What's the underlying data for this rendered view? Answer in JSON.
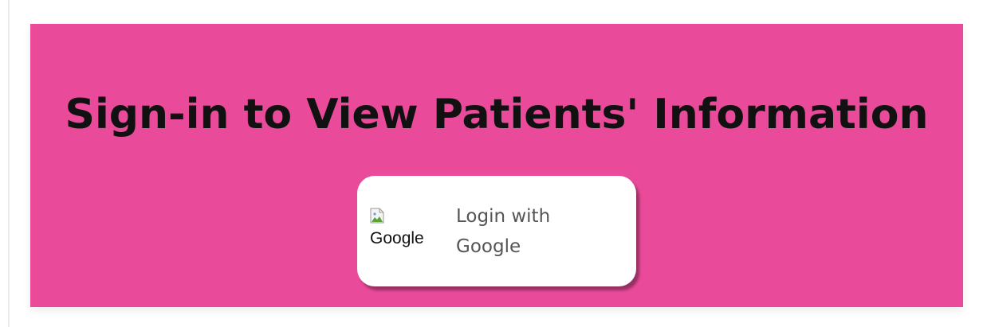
{
  "banner": {
    "title": "Sign-in to View Patients' Information",
    "background_color": "#e94a99"
  },
  "login_button": {
    "image_alt": "Google",
    "image_icon": "broken-image-icon",
    "label_line1": "Login with",
    "label_line2": "Google"
  }
}
